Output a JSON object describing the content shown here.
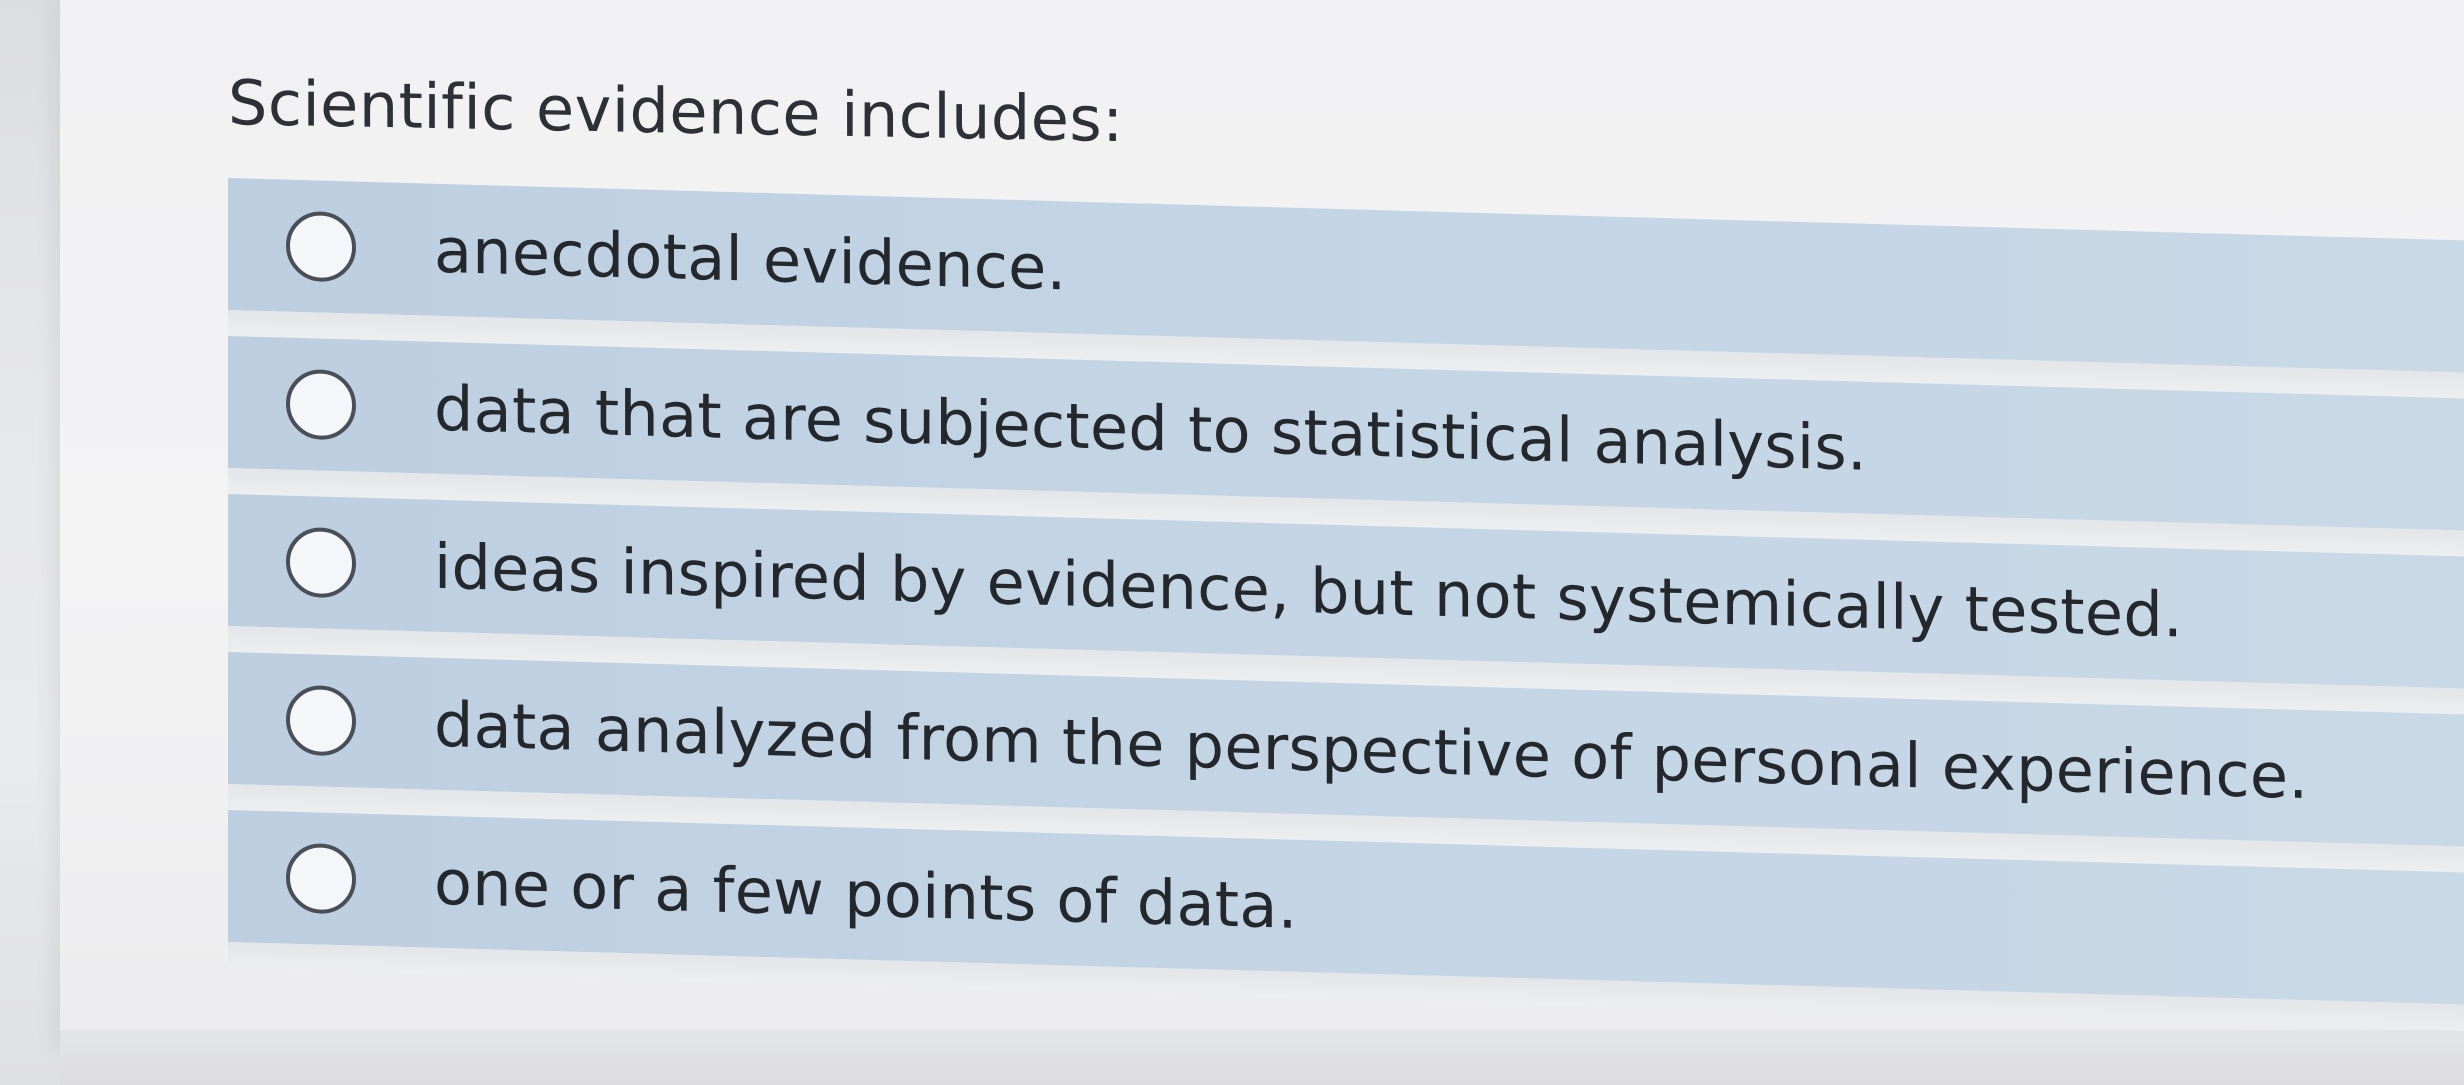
{
  "question": {
    "text": "Scientific evidence includes:"
  },
  "options": [
    {
      "label": "anecdotal evidence.",
      "selected": false
    },
    {
      "label": "data that are subjected to statistical analysis.",
      "selected": false
    },
    {
      "label": "ideas inspired by evidence, but not systemically tested.",
      "selected": false
    },
    {
      "label": "data analyzed from the perspective of personal experience.",
      "selected": false
    },
    {
      "label": "one or a few points of data.",
      "selected": false
    }
  ],
  "colors": {
    "option_background": "#c3d4e5",
    "page_background": "#f1f1f3",
    "text": "#24272c",
    "radio_border": "#4a4f57"
  }
}
